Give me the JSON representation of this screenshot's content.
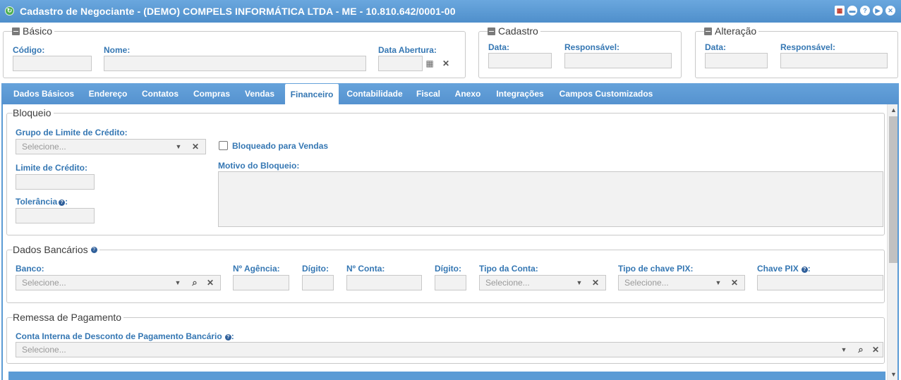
{
  "window": {
    "title": "Cadastro de Negociante - (DEMO) COMPELS INFORMÁTICA LTDA - ME - 10.810.642/0001-00",
    "buttons": [
      "calendar-icon",
      "minimize-icon",
      "help-icon",
      "next-icon",
      "close-icon"
    ]
  },
  "basico": {
    "legend": "Básico",
    "codigo_label": "Código:",
    "codigo_value": "",
    "nome_label": "Nome:",
    "nome_value": "",
    "data_abertura_label": "Data Abertura:",
    "data_abertura_value": ""
  },
  "cadastro": {
    "legend": "Cadastro",
    "data_label": "Data:",
    "responsavel_label": "Responsável:"
  },
  "alteracao": {
    "legend": "Alteração",
    "data_label": "Data:",
    "responsavel_label": "Responsável:"
  },
  "tabs": [
    {
      "label": "Dados Básicos"
    },
    {
      "label": "Endereço"
    },
    {
      "label": "Contatos"
    },
    {
      "label": "Compras"
    },
    {
      "label": "Vendas"
    },
    {
      "label": "Financeiro",
      "active": true
    },
    {
      "label": "Contabilidade"
    },
    {
      "label": "Fiscal"
    },
    {
      "label": "Anexo"
    },
    {
      "label": "Integrações"
    },
    {
      "label": "Campos Customizados"
    }
  ],
  "bloqueio": {
    "legend": "Bloqueio",
    "grupo_label": "Grupo de Limite de Crédito:",
    "grupo_placeholder": "Selecione...",
    "bloqueado_label": "Bloqueado para Vendas",
    "bloqueado_checked": false,
    "limite_label": "Limite de Crédito:",
    "motivo_label": "Motivo do Bloqueio:",
    "tolerancia_label": "Tolerância"
  },
  "dados_bancarios": {
    "legend": "Dados Bancários",
    "banco_label": "Banco:",
    "banco_placeholder": "Selecione...",
    "agencia_label": "Nº Agência:",
    "digito_label": "Dígito:",
    "conta_label": "Nº Conta:",
    "digito2_label": "Dígito:",
    "tipo_conta_label": "Tipo da Conta:",
    "tipo_conta_placeholder": "Selecione...",
    "tipo_pix_label": "Tipo de chave PIX:",
    "tipo_pix_placeholder": "Selecione...",
    "chave_pix_label": "Chave PIX"
  },
  "remessa": {
    "legend": "Remessa de Pagamento",
    "conta_label": "Conta Interna de Desconto de Pagamento Bancário",
    "conta_placeholder": "Selecione..."
  },
  "colors": {
    "header_blue": "#5b9bd5",
    "label_blue": "#3577b3"
  }
}
